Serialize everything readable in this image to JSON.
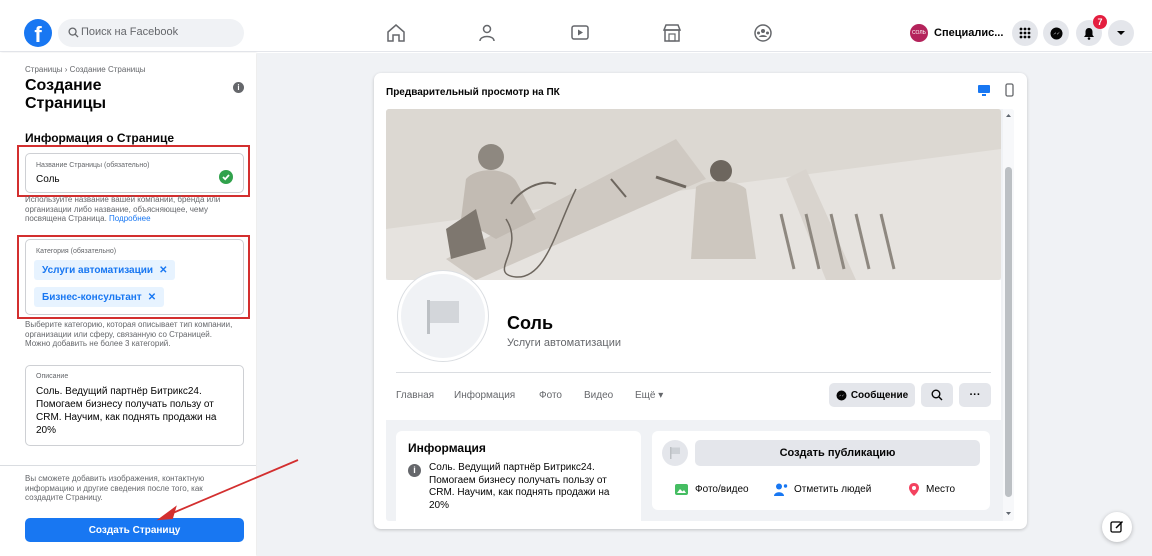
{
  "topbar": {
    "search_placeholder": "Поиск на Facebook",
    "account_name": "Специалис...",
    "notifications_count": "7"
  },
  "left": {
    "breadcrumb": "Страницы › Создание Страницы",
    "title": "Создание Страницы",
    "section_title": "Информация о Странице",
    "name_field": {
      "label": "Название Страницы (обязательно)",
      "value": "Соль"
    },
    "name_hint": "Используйте название вашей компании, бренда или организации либо название, объясняющее, чему посвящена Страница.",
    "name_hint_link": "Подробнее",
    "category_field": {
      "label": "Категория (обязательно)",
      "chips": [
        "Услуги автоматизации",
        "Бизнес-консультант"
      ]
    },
    "category_hint": "Выберите категорию, которая описывает тип компании, организации или сферу, связанную со Страницей. Можно добавить не более 3 категорий.",
    "description_field": {
      "label": "Описание",
      "value": "Соль. Ведущий партнёр Битрикс24. Помогаем бизнесу получать пользу от CRM. Научим, как поднять продажи на 20%"
    },
    "bottom_hint": "Вы сможете добавить изображения, контактную информацию и другие сведения после того, как создадите Страницу.",
    "create_button": "Создать Страницу"
  },
  "preview": {
    "title": "Предварительный просмотр на ПК",
    "page_name": "Соль",
    "page_category": "Услуги автоматизации",
    "tabs": [
      "Главная",
      "Информация",
      "Фото",
      "Видео",
      "Ещё ▾"
    ],
    "message_button": "Сообщение",
    "info_title": "Информация",
    "info_text": "Соль. Ведущий партнёр Битрикс24. Помогаем бизнесу получать пользу от CRM. Научим, как поднять продажи на 20%",
    "create_post": "Создать публикацию",
    "post_actions": [
      "Фото/видео",
      "Отметить людей",
      "Место"
    ]
  },
  "colors": {
    "brand": "#1877f2",
    "highlight": "#d32f2f",
    "success": "#31a24c"
  }
}
